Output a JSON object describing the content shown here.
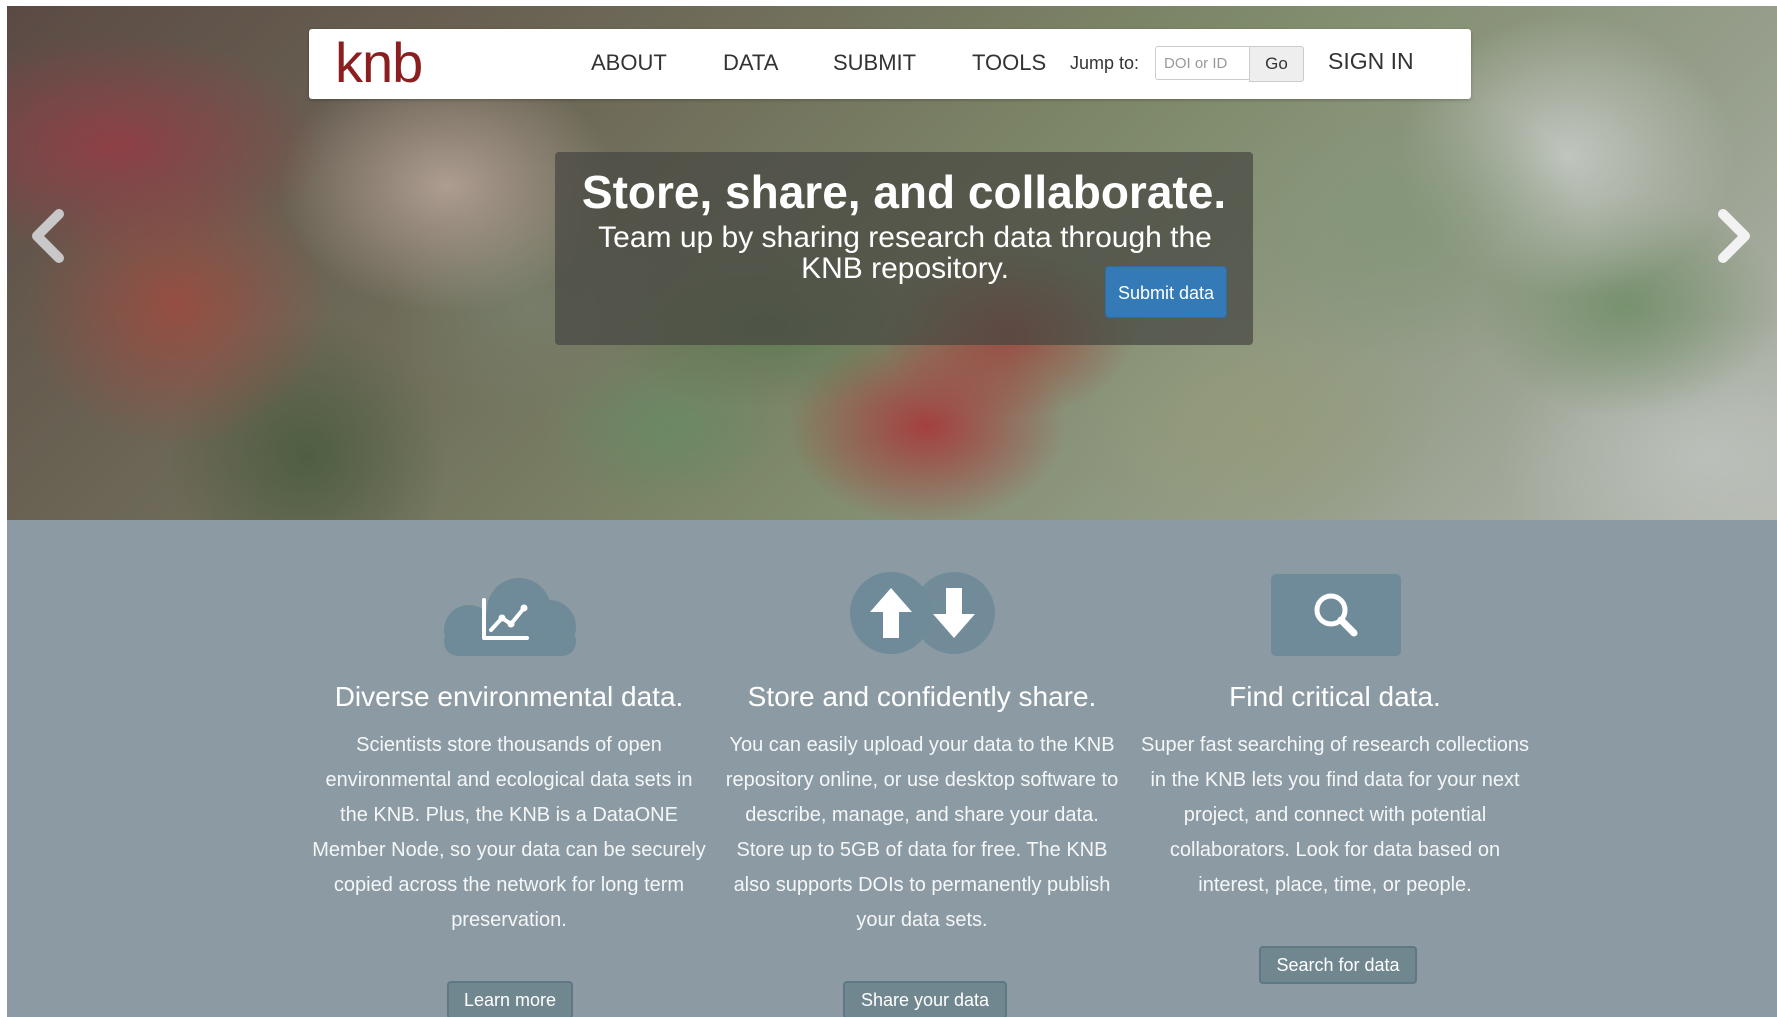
{
  "navbar": {
    "logo": "knb",
    "links": [
      "ABOUT",
      "DATA",
      "SUBMIT",
      "TOOLS"
    ],
    "jump_label": "Jump to:",
    "jump_placeholder": "DOI or ID",
    "go_label": "Go",
    "sign_in": "SIGN IN"
  },
  "hero": {
    "title": "Store, share, and collaborate.",
    "subtitle": "Team up by sharing research data through the KNB repository.",
    "submit_label": "Submit data"
  },
  "features": [
    {
      "icon": "cloud-chart-icon",
      "title": "Diverse environmental data.",
      "text": "Scientists store thousands of open environmental and ecological data sets in the KNB. Plus, the KNB is a DataONE Member Node, so your data can be securely copied across the network for long term preservation.",
      "button": "Learn more"
    },
    {
      "icon": "upload-download-icon",
      "title": "Store and confidently share.",
      "text": "You can easily upload your data to the KNB repository online, or use desktop software to describe, manage, and share your data. Store up to 5GB of data for free. The KNB also supports DOIs to permanently publish your data sets.",
      "button": "Share your data"
    },
    {
      "icon": "search-icon",
      "title": "Find critical data.",
      "text": "Super fast searching of research collections in the KNB lets you find data for your next project, and connect with potential collaborators. Look for data based on interest, place, time, or people.",
      "button": "Search for data"
    }
  ],
  "colors": {
    "logo": "#8b1f1f",
    "primary_button": "#337ab7",
    "features_bg": "#8c9ba3",
    "icon_bg": "#6f8a98"
  }
}
